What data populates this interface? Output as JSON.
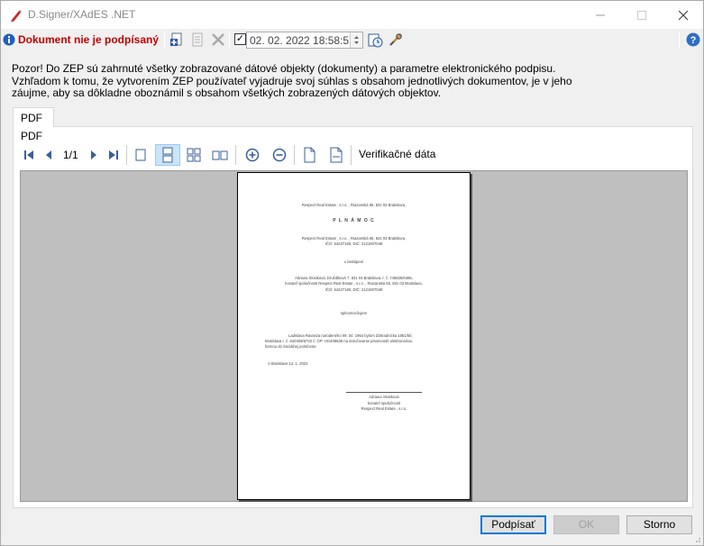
{
  "window": {
    "title": "D.Signer/XAdES .NET"
  },
  "toolbar": {
    "status": "Dokument nie je podpísaný",
    "timestamp_checked": true,
    "datetime": "02. 02. 2022 18:58:57"
  },
  "notice": {
    "line1": "Pozor! Do ZEP sú zahrnuté všetky zobrazované dátové objekty (dokumenty) a parametre elektronického podpisu.",
    "line2": "Vzhľadom k tomu, že vytvorením ZEP používateľ vyjadruje svoj súhlas s obsahom jednotlivých dokumentov, je v jeho",
    "line3": "záujme, aby sa dôkladne oboznámil s obsahom všetkých zobrazených dátových objektov."
  },
  "tabs": [
    {
      "label": "PDF"
    }
  ],
  "viewer": {
    "label": "PDF",
    "page_indicator": "1/1",
    "verify_label": "Verifikačné dáta"
  },
  "document": {
    "l1": "Respect Real Estate , s.r.o. , Riazanská 65, 831 03 Bratislava,",
    "l2": "P L N Á   M O C",
    "l3": "Respect Real Estate , s.r.o. , Riazanská 65, 831 03 Bratislava,",
    "l4": "IČO: 54227160, DIČ: 2121607048",
    "l5": "v zastúpení",
    "l6": "Adriana Slosiková, Druždiková 7, 831 04 Bratislava, r. č. 745826/6485,",
    "l7": "konateľ spoločnosti Respect Real Estate , s.r.o. , Riazanská 65, 831 03 Bratislava,",
    "l8": "IČO: 54227160, DIČ: 2121607048",
    "l9": "splnomocňujem",
    "l10": "Ladislava Ravasza narodeného 09. 04. 1964 bytom Záhradnícka 1851/60,",
    "l11": "Bratislava r. č. 640409/8733 č. OP: HG408636 na doručovanie písomností elektronickou",
    "l12": "formou do Sociálnej poisťovne.",
    "l13": "V Bratislave  12. 1. 2022",
    "l14": "Adriana Slosiková",
    "l15": "konateľ spoločnosti",
    "l16": "Respect Real Estate , s.r.o."
  },
  "buttons": {
    "sign": "Podpísať",
    "ok": "OK",
    "cancel": "Storno"
  },
  "colors": {
    "status_red": "#c00000",
    "viewer_bg": "#bfbfbf",
    "accent": "#0078d7"
  }
}
